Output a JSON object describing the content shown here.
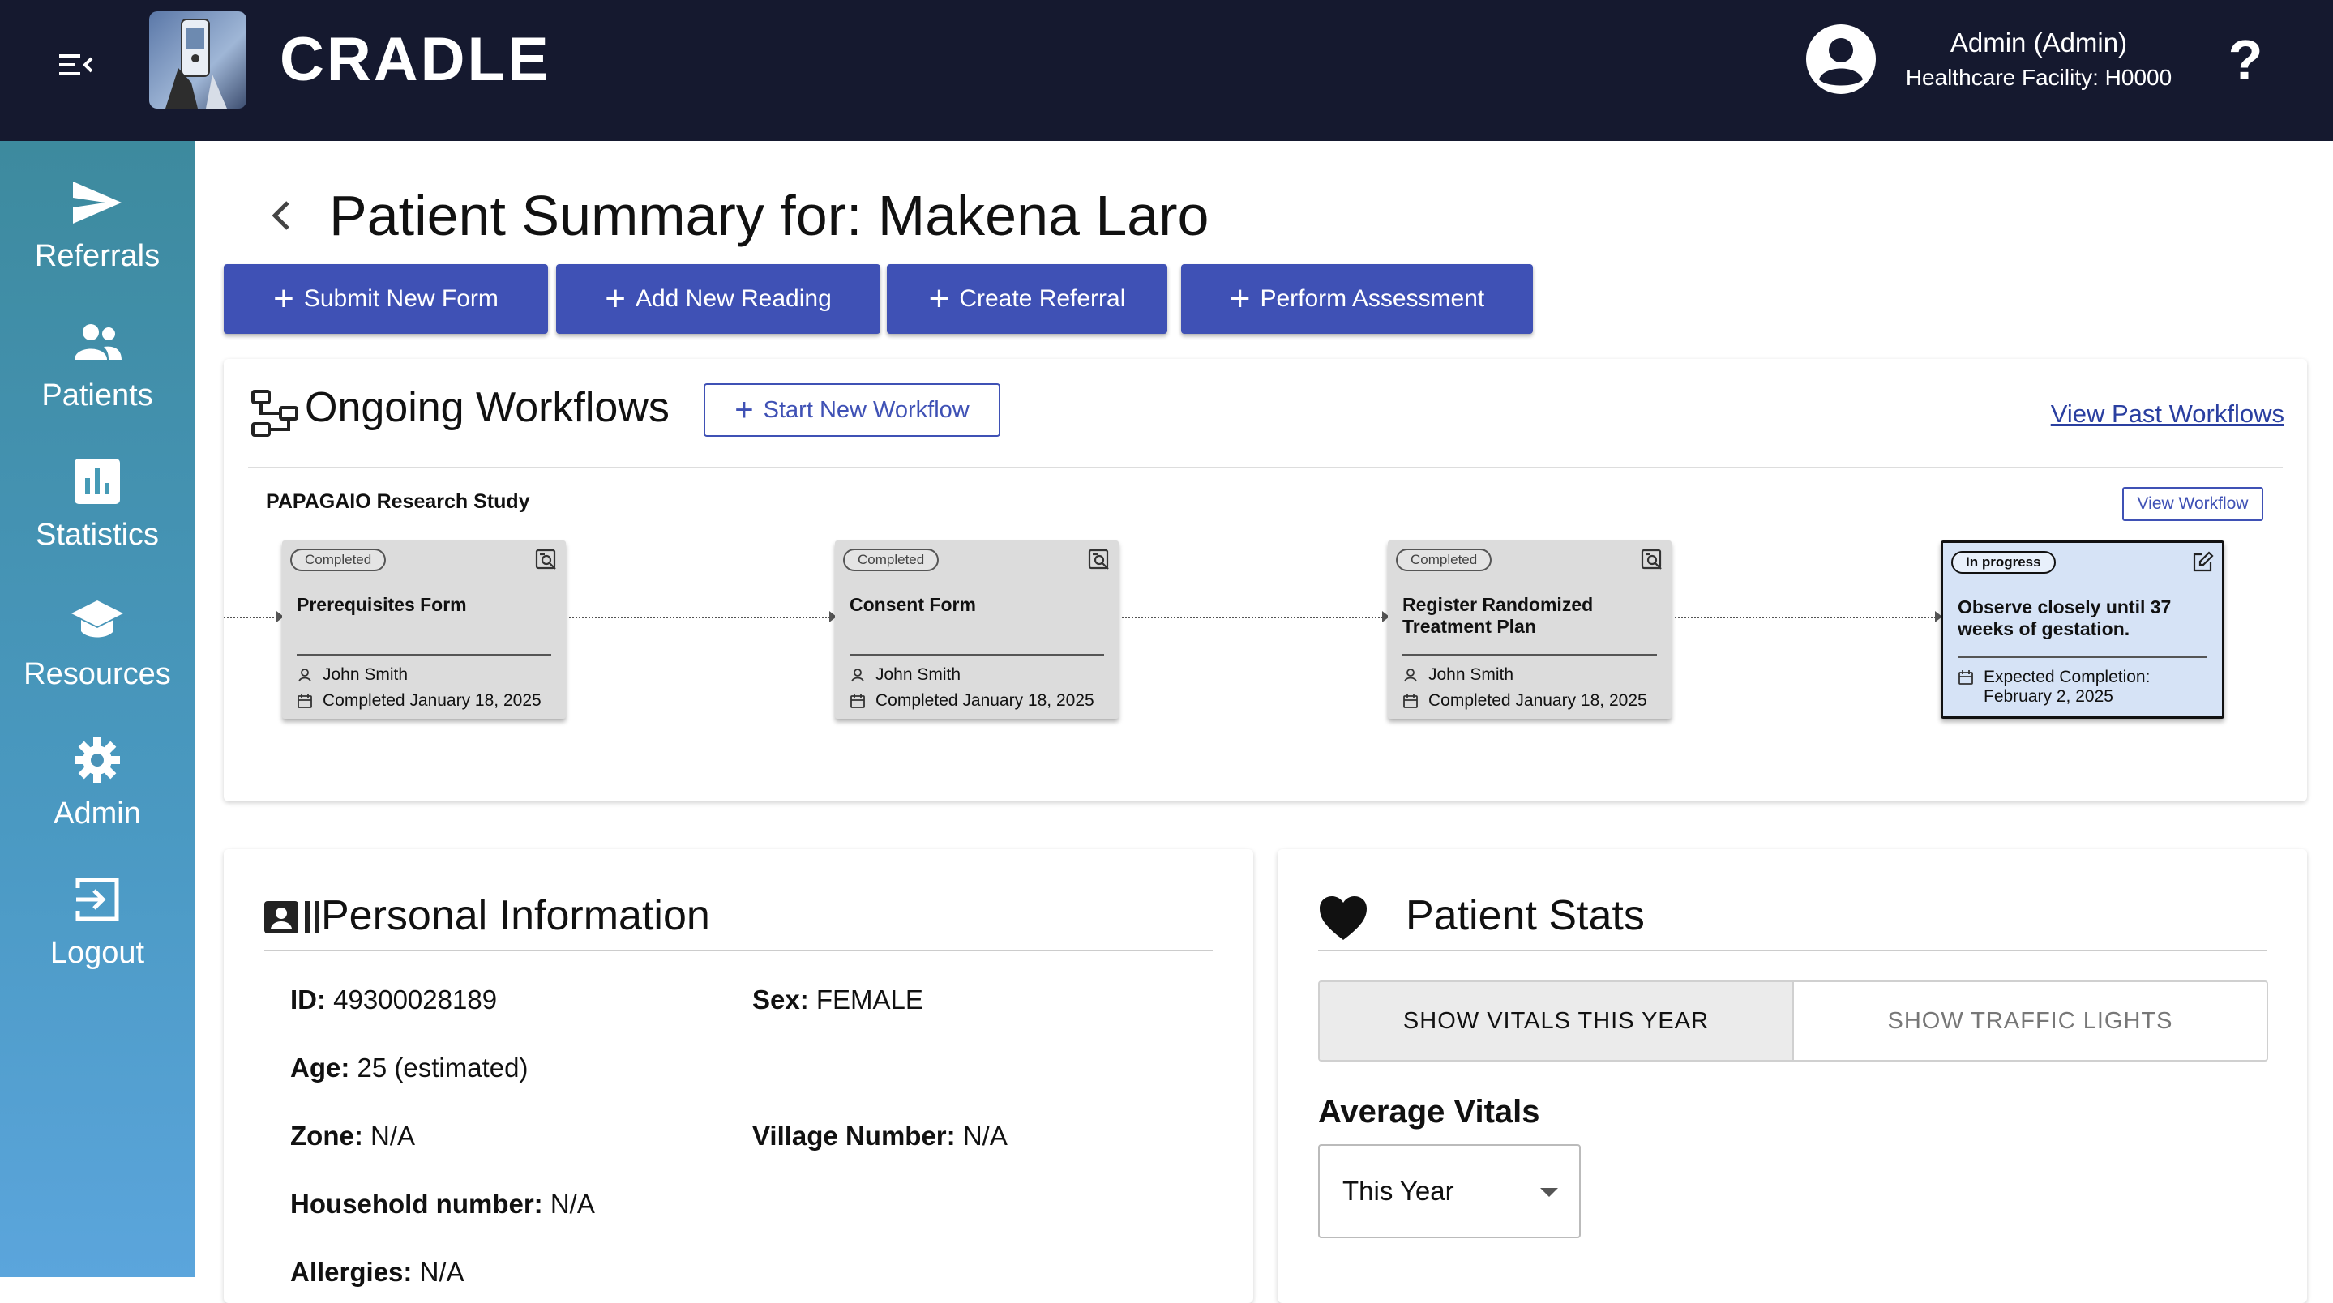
{
  "header": {
    "brand": "CRADLE",
    "user_name": "Admin (Admin)",
    "facility": "Healthcare Facility: H0000",
    "help_label": "?"
  },
  "sidebar": {
    "items": [
      {
        "label": "Referrals",
        "icon": "send-icon"
      },
      {
        "label": "Patients",
        "icon": "patients-icon"
      },
      {
        "label": "Statistics",
        "icon": "bar-chart-icon"
      },
      {
        "label": "Resources",
        "icon": "school-icon"
      },
      {
        "label": "Admin",
        "icon": "gear-icon"
      },
      {
        "label": "Logout",
        "icon": "logout-icon"
      }
    ]
  },
  "page": {
    "title": "Patient Summary for: Makena Laro"
  },
  "actions": {
    "submit_form": "Submit New Form",
    "add_reading": "Add New Reading",
    "create_referral": "Create Referral",
    "perform_assessment": "Perform Assessment"
  },
  "workflows": {
    "title": "Ongoing Workflows",
    "start_new": "Start New Workflow",
    "view_past": "View Past Workflows",
    "study_name": "PAPAGAIO Research Study",
    "view_workflow": "View Workflow",
    "steps": [
      {
        "status": "Completed",
        "name": "Prerequisites Form",
        "person": "John Smith",
        "date": "Completed January 18, 2025"
      },
      {
        "status": "Completed",
        "name": "Consent Form",
        "person": "John Smith",
        "date": "Completed January 18, 2025"
      },
      {
        "status": "Completed",
        "name": "Register Randomized Treatment Plan",
        "person": "John Smith",
        "date": "Completed January 18, 2025"
      },
      {
        "status": "In progress",
        "name": "Observe closely until 37 weeks of gestation.",
        "expected_label": "Expected Completion:",
        "expected_date": "February 2, 2025"
      }
    ]
  },
  "personal_info": {
    "title": "Personal Information",
    "id_label": "ID:",
    "id_value": "49300028189",
    "sex_label": "Sex:",
    "sex_value": "FEMALE",
    "age_label": "Age:",
    "age_value": "25 (estimated)",
    "zone_label": "Zone:",
    "zone_value": "N/A",
    "village_label": "Village Number:",
    "village_value": "N/A",
    "household_label": "Household number:",
    "household_value": "N/A",
    "allergies_label": "Allergies:",
    "allergies_value": "N/A"
  },
  "patient_stats": {
    "title": "Patient Stats",
    "tab_vitals": "SHOW VITALS THIS YEAR",
    "tab_traffic": "SHOW TRAFFIC LIGHTS",
    "avg_title": "Average Vitals",
    "period_selected": "This Year"
  },
  "colors": {
    "header_bg": "#15192f",
    "primary": "#3f51b5",
    "sidebar_top": "#3d8a9e",
    "sidebar_bottom": "#5ba5dc"
  }
}
